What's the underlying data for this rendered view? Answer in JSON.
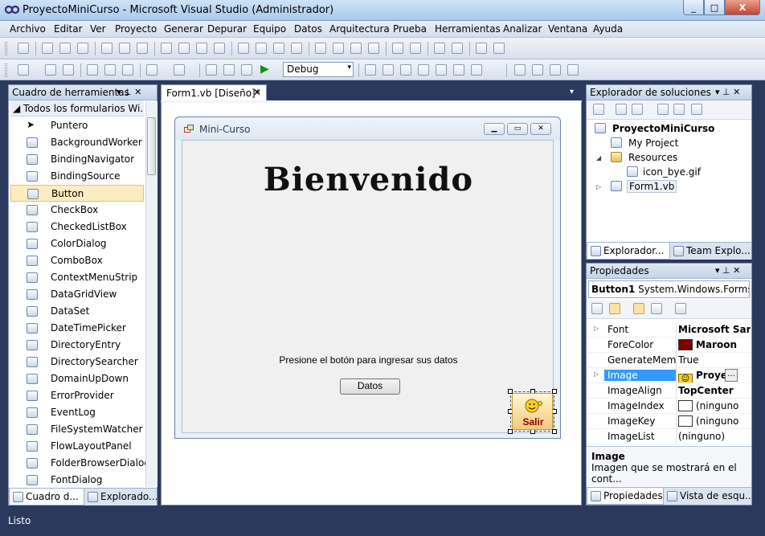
{
  "window": {
    "title": "ProyectoMiniCurso - Microsoft Visual Studio (Administrador)",
    "min_glyph": "_",
    "max_glyph": "□",
    "close_glyph": "X"
  },
  "menu": [
    "Archivo",
    "Editar",
    "Ver",
    "Proyecto",
    "Generar",
    "Depurar",
    "Equipo",
    "Datos",
    "Arquitectura",
    "Prueba",
    "Herramientas",
    "Analizar",
    "Ventana",
    "Ayuda"
  ],
  "toolbar": {
    "config": "Debug",
    "dropdown_glyph": "▾",
    "run_glyph": "▶"
  },
  "toolbox": {
    "title": "Cuadro de herramientas",
    "pin_glyph": "▾ ⊥ ✕",
    "group": "◢ Todos los formularios Wi...",
    "items": [
      "Puntero",
      "BackgroundWorker",
      "BindingNavigator",
      "BindingSource",
      "Button",
      "CheckBox",
      "CheckedListBox",
      "ColorDialog",
      "ComboBox",
      "ContextMenuStrip",
      "DataGridView",
      "DataSet",
      "DateTimePicker",
      "DirectoryEntry",
      "DirectorySearcher",
      "DomainUpDown",
      "ErrorProvider",
      "EventLog",
      "FileSystemWatcher",
      "FlowLayoutPanel",
      "FolderBrowserDialog",
      "FontDialog"
    ],
    "selected_index": 4,
    "tabs": [
      "Cuadro d...",
      "Explorado..."
    ]
  },
  "document": {
    "tab": "Form1.vb [Diseño]*",
    "tab_close": "✕",
    "dropdown": "▾"
  },
  "form": {
    "title": "Mini-Curso",
    "heading": "Bienvenido",
    "prompt": "Presione el botón para ingresar sus datos",
    "datos_button": "Datos",
    "salir_button": "Salir",
    "min_glyph": "▁",
    "max_glyph": "▭",
    "close_glyph": "✕"
  },
  "solution_explorer": {
    "title": "Explorador de soluciones",
    "pin_glyph": "▾ ⊥ ✕",
    "nodes": [
      {
        "label": "ProyectoMiniCurso",
        "bold": true
      },
      {
        "label": "My Project"
      },
      {
        "label": "Resources"
      },
      {
        "label": "icon_bye.gif"
      },
      {
        "label": "Form1.vb"
      }
    ],
    "expanded_glyph": "◢",
    "collapsed_glyph": "▷",
    "tabs": [
      "Explorador...",
      "Team Explo..."
    ]
  },
  "properties": {
    "title": "Propiedades",
    "pin_glyph": "▾ ⊥ ✕",
    "object_name": "Button1",
    "object_type": "System.Windows.Forms.B",
    "rows": [
      {
        "name": "Font",
        "value": "Microsoft Sar",
        "bold": true,
        "expand": true
      },
      {
        "name": "ForeColor",
        "value": "Maroon",
        "bold": true,
        "swatch": "#800000"
      },
      {
        "name": "GenerateMemb",
        "value": "True"
      },
      {
        "name": "Image",
        "value": "Proye",
        "bold": true,
        "expand": true,
        "selected": true
      },
      {
        "name": "ImageAlign",
        "value": "TopCenter",
        "bold": true
      },
      {
        "name": "ImageIndex",
        "value": "(ninguno",
        "swatch": "#ffffff"
      },
      {
        "name": "ImageKey",
        "value": "(ninguno",
        "swatch": "#ffffff"
      },
      {
        "name": "ImageList",
        "value": "(ninguno)"
      }
    ],
    "ellipsis": "...",
    "desc_title": "Image",
    "desc_text": "Imagen que se mostrará en el cont...",
    "tabs": [
      "Propiedades",
      "Vista de esqu..."
    ]
  },
  "status": "Listo",
  "colors": {
    "maroon": "#800000",
    "selection": "#3399ff",
    "toolbox_selected": "#fbecc1"
  }
}
